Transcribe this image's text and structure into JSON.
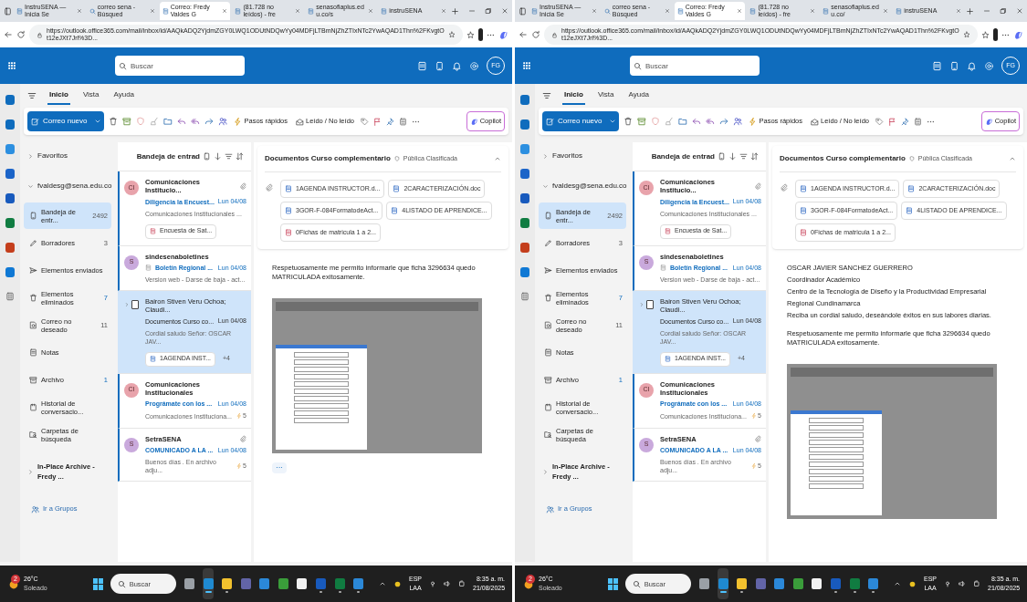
{
  "screens": [
    {
      "browser_tabs": [
        {
          "title": "InstruSENA — Inicia Se",
          "selected": false
        },
        {
          "title": "correo sena - Búsqued",
          "selected": false
        },
        {
          "title": "Correo: Fredy Valdes G",
          "selected": true
        },
        {
          "title": "(81.728 no leídos) - fre",
          "selected": false
        },
        {
          "title": "senasofiaplus.edu.co/s",
          "selected": false
        },
        {
          "title": "instruSENA",
          "selected": false
        }
      ],
      "address_bar": {
        "url": "https://outlook.office365.com/mail/inbox/id/AAQkADQ2YjdmZGY0LWQ1ODUtNDQwYy04MDFjLTBmNjZhZTIxNTc2YwAQAD1Thn%2FKvgtOt12eJXt7Jrl%3D..."
      },
      "search": {
        "placeholder": "Buscar"
      },
      "avatar": "FG",
      "ribbon_tabs": [
        {
          "label": "Inicio",
          "selected": true
        },
        {
          "label": "Vista",
          "selected": false
        },
        {
          "label": "Ayuda",
          "selected": false
        }
      ],
      "toolbar": {
        "new_mail": "Correo nuevo",
        "quick_steps": "Pasos rápidos",
        "read_unread": "Leído / No leído",
        "copilot": "Copilot"
      },
      "folders": {
        "favorites": "Favoritos",
        "account": "fvaldesg@sena.edu.co",
        "items": [
          {
            "label": "Bandeja de entr...",
            "count": "2492",
            "count_unread": false,
            "selected": true
          },
          {
            "label": "Borradores",
            "count": "3",
            "count_unread": false,
            "selected": false
          },
          {
            "label": "Elementos enviados",
            "selected": false
          },
          {
            "label": "Elementos eliminados",
            "count": "7",
            "count_unread": true,
            "selected": false
          },
          {
            "label": "Correo no deseado",
            "count": "11",
            "count_unread": false,
            "selected": false
          },
          {
            "label": "Notas",
            "selected": false
          },
          {
            "label": "Archivo",
            "count": "1",
            "count_unread": true,
            "selected": false
          },
          {
            "label": "Historial de conversacio...",
            "selected": false
          },
          {
            "label": "Carpetas de búsqueda",
            "selected": false
          }
        ],
        "archive": "In-Place Archive -Fredy ...",
        "groups": "Ir a Grupos"
      },
      "message_list": {
        "title": "Bandeja de entrad",
        "messages": [
          {
            "kind": "contact",
            "initials": "CI",
            "color": "#e8a3ab",
            "sender": "Comunicaciones Institucio...",
            "subject": "Diligencia la Encuest...",
            "date": "Lun 04/08",
            "preview": "Comunicaciones Institucionales ...",
            "unread": true,
            "selected": false,
            "has_clip": true,
            "attachment": "Encuesta de Sat..."
          },
          {
            "kind": "contact",
            "initials": "S",
            "color": "#c9a9dc",
            "sender": "sindesenaboletines",
            "subject": "Boletín Regional ...",
            "date": "Lun 04/08",
            "preview": "Version web - Darse de baja - act...",
            "unread": true,
            "selected": false,
            "has_clip": false
          },
          {
            "kind": "thread",
            "checked": false,
            "sender": "Bairon Stiven Veru Ochoa; Claudi...",
            "subject": "Documentos Curso co...",
            "date": "Lun 04/08",
            "preview": "Cordial saludo Señor: OSCAR JAV...",
            "unread": false,
            "selected": true,
            "has_clip": false,
            "attachment": "1AGENDA INST...",
            "extra": "+4"
          },
          {
            "kind": "contact",
            "initials": "CI",
            "color": "#e8a3ab",
            "sender": "Comunicaciones Institucionales",
            "subject": "Prográmate con los ...",
            "date": "Lun 04/08",
            "preview": "Comunicaciones Instituciona...",
            "reactions": "5",
            "unread": true,
            "selected": false,
            "has_clip": false
          },
          {
            "kind": "contact",
            "initials": "S",
            "color": "#c9a9dc",
            "sender": "SetraSENA",
            "subject": "COMUNICADO A LA ...",
            "date": "Lun 04/08",
            "preview": "Buenos días . En archivo adju...",
            "reactions": "5",
            "unread": true,
            "selected": false,
            "has_clip": true
          }
        ]
      },
      "reading": {
        "subject": "Documentos Curso complementario",
        "label": "Pública Clasificada",
        "attachments": [
          {
            "name": "1AGENDA INSTRUCTOR.d...",
            "kind": "word"
          },
          {
            "name": "2CARACTERIZACIÓN.doc",
            "kind": "word"
          },
          {
            "name": "3GOR-F-084FormatodeAct...",
            "kind": "word"
          },
          {
            "name": "4LISTADO DE APRENDICE...",
            "kind": "word"
          },
          {
            "name": "0Fichas de matricula 1 a 2...",
            "kind": "pdf"
          }
        ],
        "paragraphs": [
          [
            "Respetuosamente me permito informarle que ficha 3296634 quedo MATRICULADA exitosamente."
          ]
        ],
        "more_button": "···"
      },
      "taskbar": {
        "weather": {
          "badge": "2",
          "temperature": "26°C",
          "condition": "Soleado"
        },
        "search_placeholder": "Buscar",
        "apps": [
          {
            "running": false,
            "focused": false
          },
          {
            "running": true,
            "focused": true
          },
          {
            "running": true,
            "focused": false
          },
          {
            "running": false,
            "focused": false
          },
          {
            "running": false,
            "focused": false
          },
          {
            "running": false,
            "focused": false
          },
          {
            "running": false,
            "focused": false
          },
          {
            "running": true,
            "focused": false
          },
          {
            "running": true,
            "focused": false
          },
          {
            "running": true,
            "focused": false
          }
        ],
        "language": "ESP",
        "layout": "LAA",
        "time": "8:35 a. m.",
        "date": "21/08/2025"
      }
    },
    {
      "browser_tabs": [
        {
          "title": "InstruSENA — Inicia Se",
          "selected": false
        },
        {
          "title": "correo sena - Búsqued",
          "selected": false
        },
        {
          "title": "Correo: Fredy Valdes G",
          "selected": true
        },
        {
          "title": "(81.728 no leídos) - fre",
          "selected": false
        },
        {
          "title": "senasofiaplus.edu.co/",
          "selected": false
        },
        {
          "title": "instruSENA",
          "selected": false
        }
      ],
      "address_bar": {
        "url": "https://outlook.office365.com/mail/inbox/id/AAQkADQ2YjdmZGY0LWQ1ODUtNDQwYy04MDFjLTBmNjZhZTIxNTc2YwAQAD1Thn%2FKvgtOt12eJXt7Jrl%3D..."
      },
      "search": {
        "placeholder": "Buscar"
      },
      "avatar": "FG",
      "ribbon_tabs": [
        {
          "label": "Inicio",
          "selected": true
        },
        {
          "label": "Vista",
          "selected": false
        },
        {
          "label": "Ayuda",
          "selected": false
        }
      ],
      "toolbar": {
        "new_mail": "Correo nuevo",
        "quick_steps": "Pasos rápidos",
        "read_unread": "Leído / No leído",
        "copilot": "Copilot"
      },
      "folders": {
        "favorites": "Favoritos",
        "account": "fvaldesg@sena.edu.co",
        "items": [
          {
            "label": "Bandeja de entr...",
            "count": "2492",
            "count_unread": false,
            "selected": true
          },
          {
            "label": "Borradores",
            "count": "3",
            "count_unread": false,
            "selected": false
          },
          {
            "label": "Elementos enviados",
            "selected": false
          },
          {
            "label": "Elementos eliminados",
            "count": "7",
            "count_unread": true,
            "selected": false
          },
          {
            "label": "Correo no deseado",
            "count": "11",
            "count_unread": false,
            "selected": false
          },
          {
            "label": "Notas",
            "selected": false
          },
          {
            "label": "Archivo",
            "count": "1",
            "count_unread": true,
            "selected": false
          },
          {
            "label": "Historial de conversacio...",
            "selected": false
          },
          {
            "label": "Carpetas de búsqueda",
            "selected": false
          }
        ],
        "archive": "In-Place Archive -Fredy ...",
        "groups": "Ir a Grupos"
      },
      "message_list": {
        "title": "Bandeja de entrad",
        "messages": [
          {
            "kind": "contact",
            "initials": "CI",
            "color": "#e8a3ab",
            "sender": "Comunicaciones Institucio...",
            "subject": "Diligencia la Encuest...",
            "date": "Lun 04/08",
            "preview": "Comunicaciones Institucionales ...",
            "unread": true,
            "selected": false,
            "has_clip": true,
            "attachment": "Encuesta de Sat..."
          },
          {
            "kind": "contact",
            "initials": "S",
            "color": "#c9a9dc",
            "sender": "sindesenaboletines",
            "subject": "Boletín Regional ...",
            "date": "Lun 04/08",
            "preview": "Version web - Darse de baja - act...",
            "unread": true,
            "selected": false,
            "has_clip": false
          },
          {
            "kind": "thread",
            "checked": false,
            "sender": "Bairon Stiven Veru Ochoa; Claudi...",
            "subject": "Documentos Curso co...",
            "date": "Lun 04/08",
            "preview": "Cordial saludo Señor: OSCAR JAV...",
            "unread": false,
            "selected": true,
            "has_clip": false,
            "attachment": "1AGENDA INST...",
            "extra": "+4"
          },
          {
            "kind": "contact",
            "initials": "CI",
            "color": "#e8a3ab",
            "sender": "Comunicaciones Institucionales",
            "subject": "Prográmate con los ...",
            "date": "Lun 04/08",
            "preview": "Comunicaciones Instituciona...",
            "reactions": "5",
            "unread": true,
            "selected": false,
            "has_clip": false
          },
          {
            "kind": "contact",
            "initials": "S",
            "color": "#c9a9dc",
            "sender": "SetraSENA",
            "subject": "COMUNICADO A LA ...",
            "date": "Lun 04/08",
            "preview": "Buenos días . En archivo adju...",
            "reactions": "5",
            "unread": true,
            "selected": false,
            "has_clip": true
          }
        ]
      },
      "reading": {
        "subject": "Documentos Curso complementario",
        "label": "Pública Clasificada",
        "attachments": [
          {
            "name": "1AGENDA INSTRUCTOR.d...",
            "kind": "word"
          },
          {
            "name": "2CARACTERIZACIÓN.doc",
            "kind": "word"
          },
          {
            "name": "3GOR-F-084FormatodeAct...",
            "kind": "word"
          },
          {
            "name": "4LISTADO DE APRENDICE...",
            "kind": "word"
          },
          {
            "name": "0Fichas de matricula 1 a 2...",
            "kind": "pdf"
          }
        ],
        "paragraphs": [
          [
            "OSCAR JAVIER SANCHEZ GUERRERO",
            "Coordinador Académico",
            "Centro de la Tecnología de Diseño y la Productividad Empresarial",
            "Regional Cundinamarca",
            "Reciba un cordial saludo, deseándole éxitos en sus labores diarias."
          ],
          [
            "Respetuosamente me permito informarle que ficha 3296634 quedo MATRICULADA exitosamente."
          ]
        ]
      },
      "taskbar": {
        "weather": {
          "badge": "2",
          "temperature": "26°C",
          "condition": "Soleado"
        },
        "search_placeholder": "Buscar",
        "apps": [
          {
            "running": false,
            "focused": false
          },
          {
            "running": true,
            "focused": true
          },
          {
            "running": true,
            "focused": false
          },
          {
            "running": false,
            "focused": false
          },
          {
            "running": false,
            "focused": false
          },
          {
            "running": false,
            "focused": false
          },
          {
            "running": false,
            "focused": false
          },
          {
            "running": true,
            "focused": false
          },
          {
            "running": true,
            "focused": false
          },
          {
            "running": true,
            "focused": false
          }
        ],
        "language": "ESP",
        "layout": "LAA",
        "time": "8:35 a. m.",
        "date": "21/08/2025"
      }
    }
  ]
}
